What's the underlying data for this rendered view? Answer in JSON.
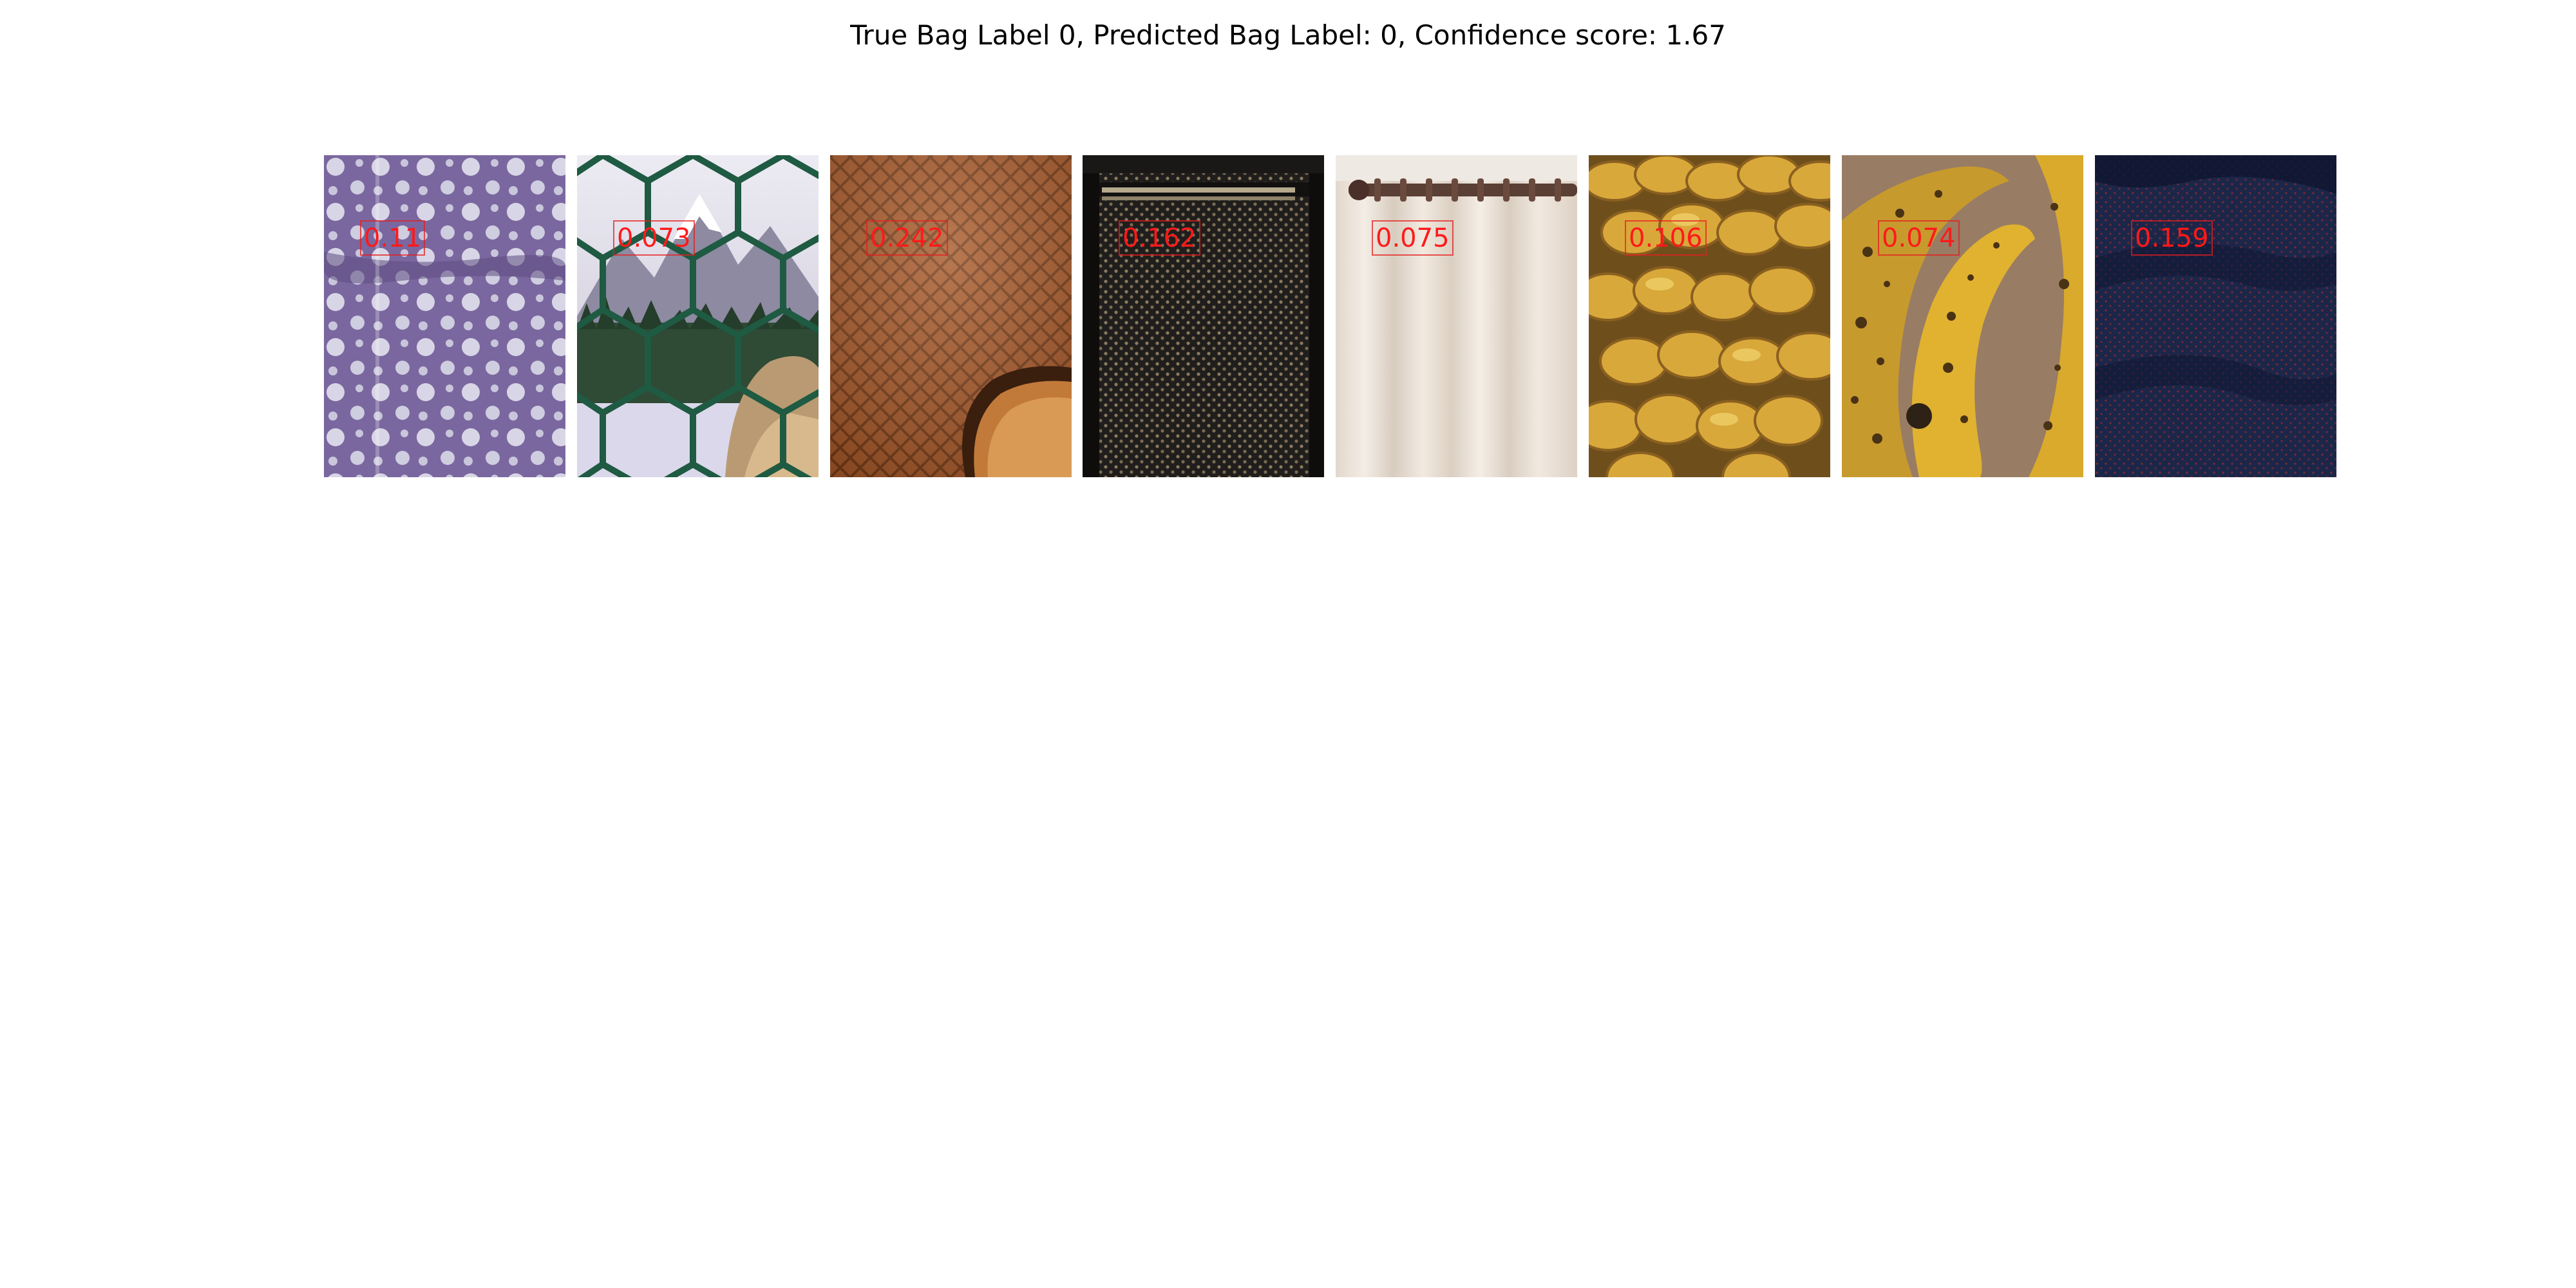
{
  "title": "True Bag Label 0, Predicted Bag Label: 0, Confidence score: 1.67",
  "instances": [
    {
      "label": "0.11",
      "image_icon": "purple-polka-dot-fabric-image"
    },
    {
      "label": "0.073",
      "image_icon": "chain-link-fence-bear-image"
    },
    {
      "label": "0.242",
      "image_icon": "waffle-cookie-image"
    },
    {
      "label": "0.162",
      "image_icon": "dotted-dark-fabric-image"
    },
    {
      "label": "0.075",
      "image_icon": "cream-curtain-rod-image"
    },
    {
      "label": "0.106",
      "image_icon": "braided-bread-image"
    },
    {
      "label": "0.074",
      "image_icon": "ripe-bananas-image"
    },
    {
      "label": "0.159",
      "image_icon": "navy-dotted-fabric-image"
    }
  ],
  "colors": {
    "score_text": "#ff1a1a",
    "score_border": "#e61e1e"
  }
}
